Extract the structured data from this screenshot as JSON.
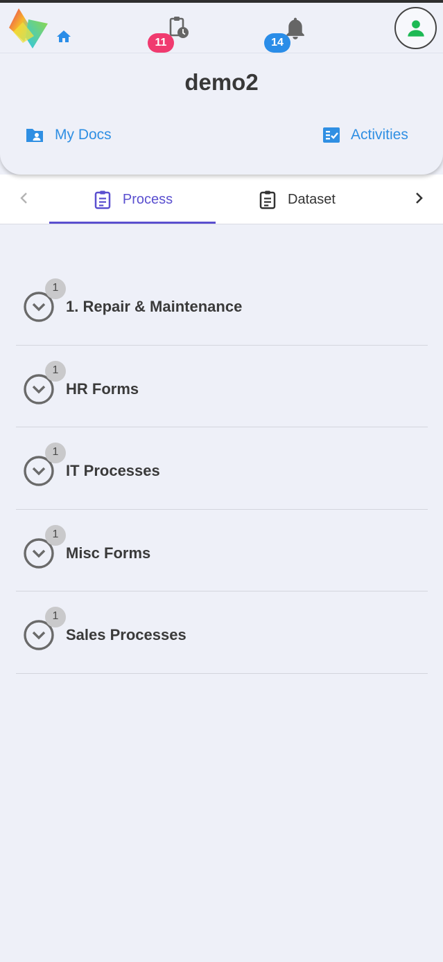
{
  "header": {
    "title": "demo2",
    "tasks_badge": "11",
    "notifications_badge": "14",
    "links": {
      "my_docs": "My Docs",
      "activities": "Activities"
    }
  },
  "tabs": {
    "items": [
      {
        "label": "Process",
        "active": true
      },
      {
        "label": "Dataset",
        "active": false
      }
    ]
  },
  "groups": [
    {
      "label": "1. Repair & Maintenance",
      "count": "1"
    },
    {
      "label": "HR Forms",
      "count": "1"
    },
    {
      "label": "IT Processes",
      "count": "1"
    },
    {
      "label": "Misc Forms",
      "count": "1"
    },
    {
      "label": "Sales Processes",
      "count": "1"
    }
  ],
  "colors": {
    "background": "#eef0f8",
    "accent": "#5a4fcf",
    "link_blue": "#2f8fe3",
    "badge_pink": "#f03a6f",
    "badge_blue": "#2a8de8",
    "avatar_green": "#1db954"
  },
  "icons": [
    "app-logo",
    "home-icon",
    "clipboard-clock-icon",
    "bell-icon",
    "user-avatar-icon",
    "folder-user-icon",
    "checklist-icon",
    "clipboard-icon",
    "chevron-left-icon",
    "chevron-right-icon",
    "chevron-down-circle-icon"
  ]
}
